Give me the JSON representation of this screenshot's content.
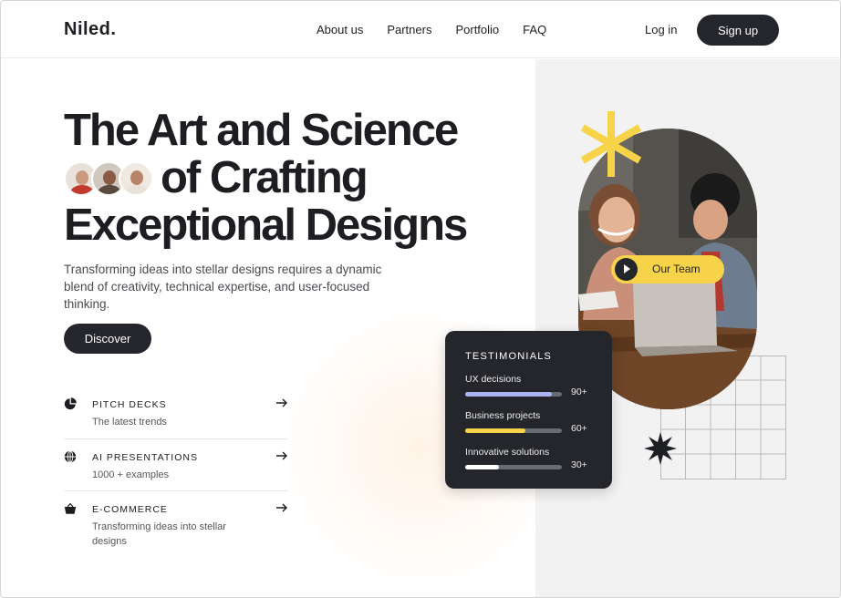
{
  "header": {
    "logo": "Niled.",
    "nav": [
      "About us",
      "Partners",
      "Portfolio",
      "FAQ"
    ],
    "login_label": "Log in",
    "signup_label": "Sign up"
  },
  "hero": {
    "line1": "The Art and Science",
    "line2": "of Crafting",
    "line3": "Exceptional Designs",
    "subtitle": "Transforming ideas into stellar designs requires a dynamic blend of creativity, technical expertise, and user-focused thinking.",
    "cta_label": "Discover"
  },
  "features": [
    {
      "icon": "pie-chart-icon",
      "title": "PITCH DECKS",
      "desc": "The latest trends"
    },
    {
      "icon": "globe-icon",
      "title": "AI PRESENTATIONS",
      "desc": "1000 + examples"
    },
    {
      "icon": "basket-icon",
      "title": "E-COMMERCE",
      "desc": "Transforming ideas into stellar designs"
    }
  ],
  "team_pill": {
    "label": "Our Team"
  },
  "testimonials": {
    "title": "TESTIMONIALS",
    "rows": [
      {
        "label": "UX decisions",
        "value": "90+",
        "fill": 0.9,
        "color": "#a9b4f0"
      },
      {
        "label": "Business projects",
        "value": "60+",
        "fill": 0.62,
        "color": "#f7d34a"
      },
      {
        "label": "Innovative solutions",
        "value": "30+",
        "fill": 0.35,
        "color": "#ffffff"
      }
    ]
  },
  "colors": {
    "accent_yellow": "#f7d34a",
    "dark": "#25262b",
    "panel": "#f2f2f2"
  }
}
